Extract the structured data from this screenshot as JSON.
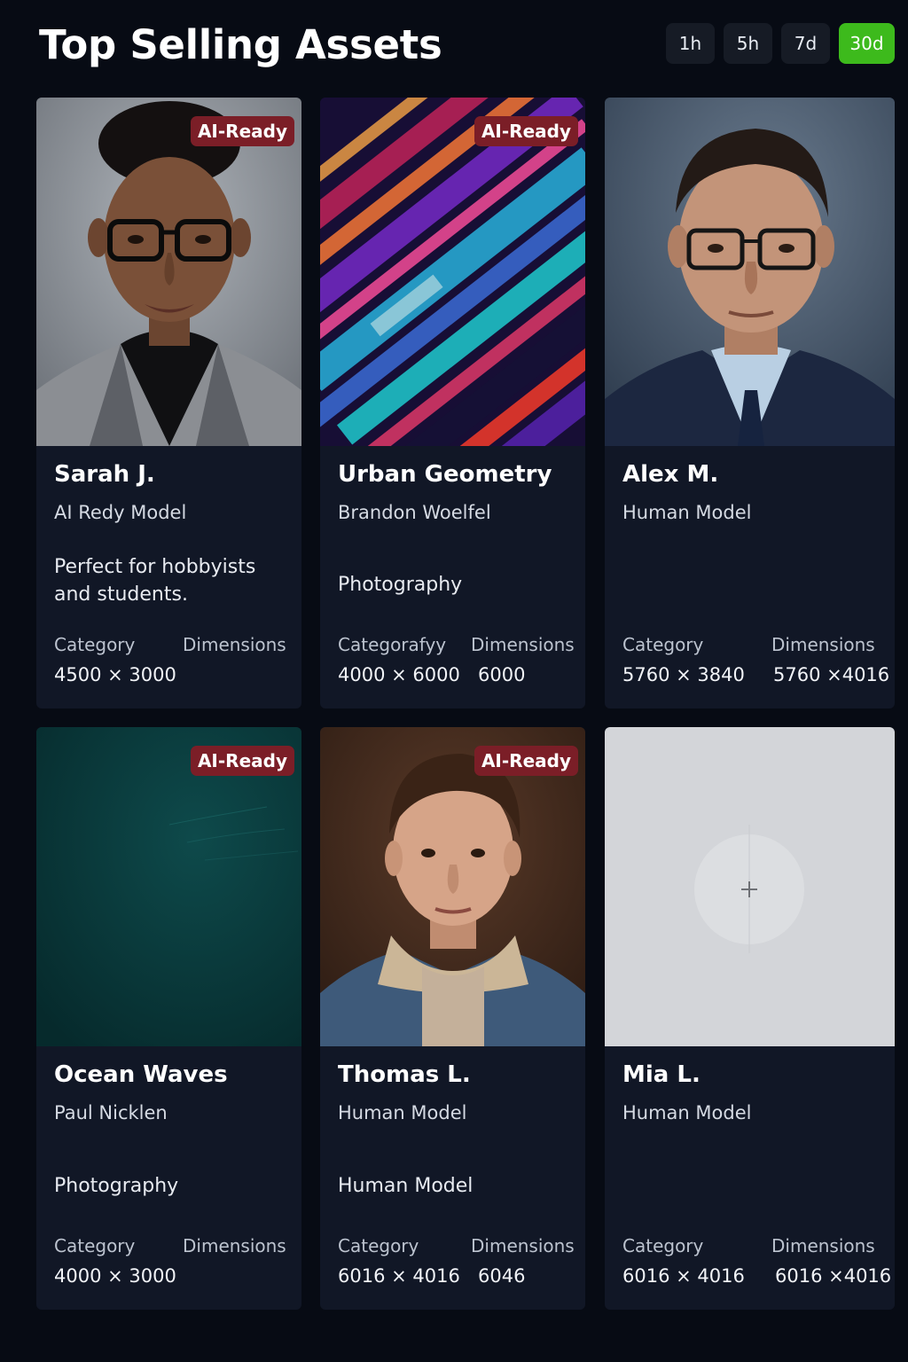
{
  "header": {
    "title": "Top Selling Assets",
    "time_filters": [
      "1h",
      "5h",
      "7d",
      "30d"
    ],
    "active_filter": "30d"
  },
  "colors": {
    "background": "#070b14",
    "card": "#111726",
    "badge": "#7b1e27",
    "active_filter": "#3dba1c"
  },
  "assets": [
    {
      "name": "Sarah J.",
      "subtitle": "AI Redy Model",
      "description": "Perfect for hobbyists and students.",
      "badge": "AI-Ready",
      "category_label": "Category",
      "dimensions_label": "Dimensions",
      "category_value": "4500 × 3000",
      "dimensions_value": "",
      "image": "portrait-woman-glasses"
    },
    {
      "name": "Urban Geometry",
      "subtitle": "Brandon Woelfel",
      "description": "Photography",
      "badge": "AI-Ready",
      "category_label": "Categorafyy",
      "dimensions_label": "Dimensions",
      "category_value": "4000 × 6000",
      "dimensions_value": "6000",
      "image": "abstract-neon-geometry"
    },
    {
      "name": "Alex M.",
      "subtitle": "Human Model",
      "description": "",
      "badge": "",
      "category_label": "Category",
      "dimensions_label": "Dimensions",
      "category_value": "5760 × 3840",
      "dimensions_value": "5760 ×4016",
      "image": "portrait-man-suit"
    },
    {
      "name": "Ocean Waves",
      "subtitle": "Paul Nicklen",
      "description": "Photography",
      "badge": "AI-Ready",
      "category_label": "Category",
      "dimensions_label": "Dimensions",
      "category_value": "4000 × 3000",
      "dimensions_value": "",
      "image": "dark-teal-water"
    },
    {
      "name": "Thomas L.",
      "subtitle": "Human Model",
      "description": "Human Model",
      "badge": "AI-Ready",
      "category_label": "Category",
      "dimensions_label": "Dimensions",
      "category_value": "6016 ×  4016",
      "dimensions_value": "6046",
      "image": "portrait-young-man-jacket"
    },
    {
      "name": "Mia L.",
      "subtitle": "Human Model",
      "description": "",
      "badge": "",
      "category_label": "Category",
      "dimensions_label": "Dimensions",
      "category_value": "6016 × 4016",
      "dimensions_value": "6016 ×4016",
      "image": "image-placeholder"
    }
  ]
}
